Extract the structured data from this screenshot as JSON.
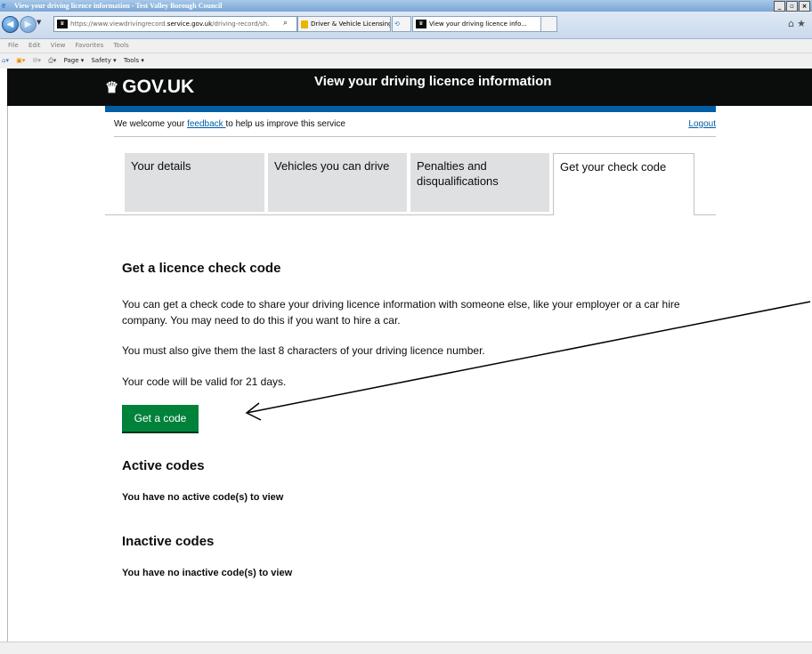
{
  "browser": {
    "window_title": "View your driving licence information - Test Valley Borough Council",
    "address": {
      "scheme": "https://",
      "subdomain": "www.viewdrivingrecord.",
      "domain": "service.gov.uk",
      "path": "/driving-record/sh."
    },
    "tabs": [
      {
        "label": "Driver & Vehicle Licensing..."
      },
      {
        "label": "View your driving licence info..."
      }
    ],
    "menu": [
      "File",
      "Edit",
      "View",
      "Favorites",
      "Tools"
    ],
    "command_bar": [
      "Page ▾",
      "Safety ▾",
      "Tools ▾"
    ]
  },
  "header": {
    "logo": "GOV.UK",
    "service_name": "View your driving licence information"
  },
  "feedback": {
    "prefix": "We welcome your ",
    "link": "feedback ",
    "suffix": "to help us improve this service",
    "logout": "Logout"
  },
  "nav_tabs": [
    {
      "label": "Your details"
    },
    {
      "label": "Vehicles you can drive"
    },
    {
      "label": "Penalties and disqualifications"
    },
    {
      "label": "Get your check code"
    }
  ],
  "main": {
    "heading": "Get a licence check code",
    "para1": "You can get a check code to share your driving licence information with someone else, like your employer or a car hire company. You may need to do this if you want to hire a car.",
    "para2": "You must also give them the last 8 characters of your driving licence number.",
    "para3": "Your code will be valid for 21 days.",
    "button": "Get a code",
    "active_heading": "Active codes",
    "active_text": "You have no active code(s) to view",
    "inactive_heading": "Inactive codes",
    "inactive_text": "You have no inactive code(s) to view"
  }
}
